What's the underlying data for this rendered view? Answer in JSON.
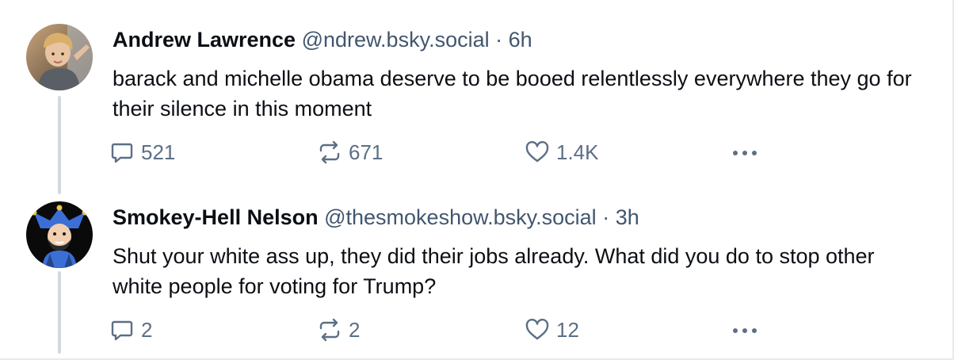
{
  "posts": [
    {
      "author": "Andrew Lawrence",
      "handle": "@ndrew.bsky.social",
      "separator": "·",
      "time": "6h",
      "text": "barack and michelle obama deserve to be booed relentlessly everywhere they go for their silence in this moment",
      "replies": "521",
      "reposts": "671",
      "likes": "1.4K",
      "avatar_icon": "child-photo-avatar"
    },
    {
      "author": "Smokey-Hell Nelson",
      "handle": "@thesmokeshow.bsky.social",
      "separator": "·",
      "time": "3h",
      "text": "Shut your white ass up, they did their jobs already. What did you do to stop other white people for voting for Trump?",
      "replies": "2",
      "reposts": "2",
      "likes": "12",
      "avatar_icon": "jester-cartoon-avatar"
    }
  ],
  "colors": {
    "name": "#0b0f14",
    "meta": "#42566e",
    "action": "#5c6f86",
    "thread_line": "#d4d9e0"
  }
}
